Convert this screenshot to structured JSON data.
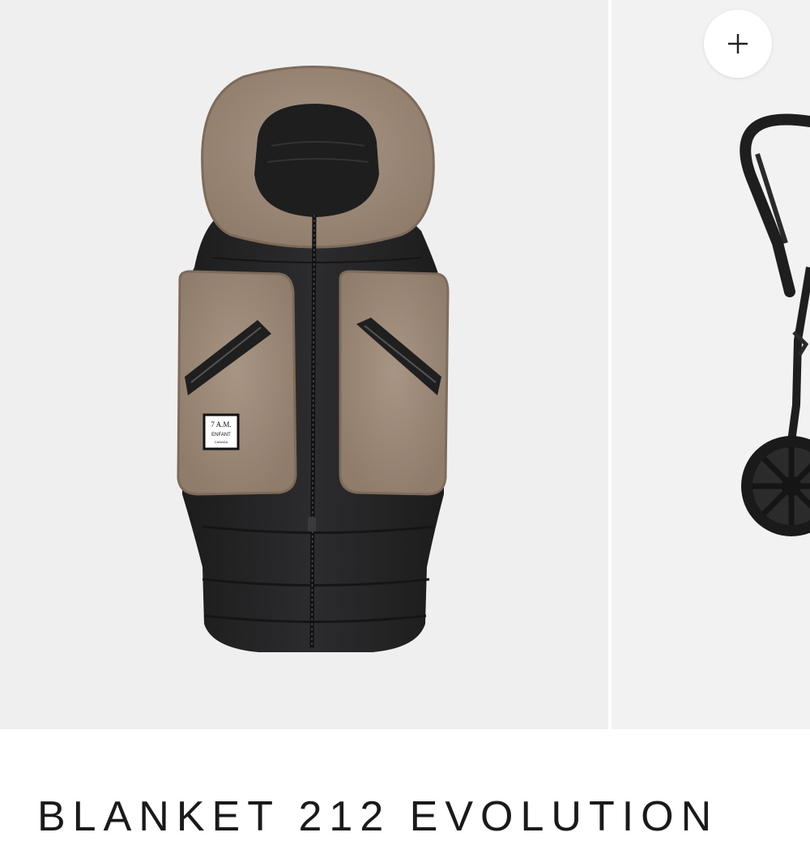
{
  "gallery": {
    "images": [
      {
        "alt": "Black footmuff with taupe sherpa hood and pockets",
        "label_text": [
          "7 A.M.",
          "ENFANT",
          "CANADA"
        ]
      },
      {
        "alt": "Black stroller frame"
      }
    ],
    "zoom_icon": "plus-icon"
  },
  "product": {
    "title": "BLANKET 212 EVOLUTION"
  },
  "colors": {
    "sherpa": "#a08c7a",
    "shell": "#232324",
    "background": "#efefef"
  }
}
